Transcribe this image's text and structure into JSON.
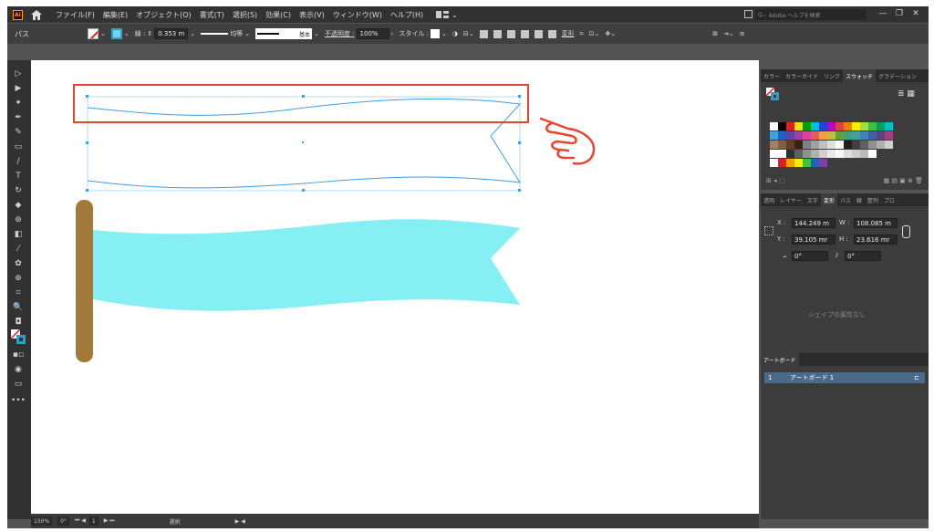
{
  "menubar": {
    "app_icon": "Ai",
    "items": [
      "ファイル(F)",
      "編集(E)",
      "オブジェクト(O)",
      "書式(T)",
      "選択(S)",
      "効果(C)",
      "表示(V)",
      "ウィンドウ(W)",
      "ヘルプ(H)"
    ],
    "search_placeholder": "Adobe ヘルプを検索",
    "icons": [
      "home-icon",
      "workspace-switcher-icon",
      "arrange-documents-icon",
      "minimize-icon",
      "restore-icon",
      "close-icon"
    ]
  },
  "controlbar": {
    "selection_label": "パス",
    "stroke_label": "線 :",
    "stroke_weight": "0.353 m",
    "profile_label": "均等",
    "brush_label": "基本",
    "opacity_label": "不透明度 :",
    "opacity_value": "100%",
    "style_label": "スタイル :",
    "transform_label": "変形"
  },
  "status": {
    "zoom": "150%",
    "rotation": "0°",
    "artboard_num": "1",
    "mode": "選択"
  },
  "swatches_panel": {
    "tabs": [
      "カラー",
      "カラーガイド",
      "リンク",
      "スウォッチ",
      "グラデーション"
    ],
    "active_tab": "スウォッチ"
  },
  "transform_panel": {
    "tabs": [
      "透明",
      "レイヤー",
      "文字",
      "変形",
      "パス",
      "線",
      "整列",
      "プロ"
    ],
    "active_tab": "変形",
    "x_label": "X :",
    "x": "144.249 m",
    "w_label": "W :",
    "w": "108.085 m",
    "y_label": "Y :",
    "y": "39.105 mr",
    "h_label": "H :",
    "h": "23.616 mr",
    "rotate": "0°",
    "shear": "0°",
    "no_shape_props": "シェイプの属性なし"
  },
  "artboards_panel": {
    "title": "アートボード",
    "rows": [
      {
        "index": "1",
        "name": "アートボード 1"
      }
    ]
  },
  "colors": {
    "highlight_box": "#e8452c",
    "flag_fill": "#86eff3",
    "pole": "#a47a3c",
    "selection": "#3aa0e8",
    "hand_pointer": "#e8452c"
  }
}
